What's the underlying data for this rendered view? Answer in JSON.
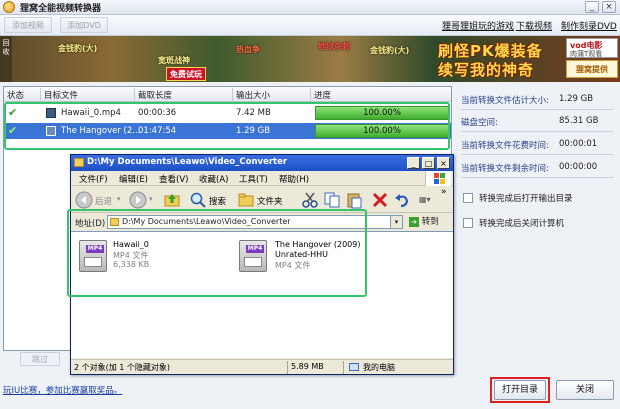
{
  "app": {
    "title": "狸窝全能视频转换器",
    "window_controls": {
      "minimize": "_",
      "close": "×"
    }
  },
  "toolbar": {
    "add_video": "添加视频",
    "add_dvd": "添加DVD",
    "links": [
      "狸哥狸姐玩的游戏",
      "下载视频",
      "制作刻录DVD"
    ]
  },
  "banner": {
    "side_text": "回收",
    "tags": [
      "金钱豹(大)",
      "宽斑战神",
      "热血争",
      "地狱杀刺",
      "金钱豹(大)"
    ],
    "buttons": [
      "免费试玩"
    ],
    "slogan_line1": "刷怪PK爆装备",
    "slogan_line2": "续写我的神奇",
    "vod_brand": "vod电影",
    "vod_sub": "肉蒲T观看",
    "logo": "狸窝提供"
  },
  "file_list": {
    "columns": [
      "状态",
      "目标文件",
      "截取长度",
      "输出大小",
      "进度"
    ],
    "rows": [
      {
        "name": "Hawaii_0.mp4",
        "duration": "00:00:36",
        "size": "7.42 MB",
        "progress_pct": 100,
        "progress_label": "100.00%"
      },
      {
        "name": "The Hangover (2...",
        "duration": "01:47:54",
        "size": "1.29 GB",
        "progress_pct": 100,
        "progress_label": "100.00%"
      }
    ],
    "skip_label": "跳过"
  },
  "info": {
    "items": [
      {
        "label": "当前转换文件估计大小:",
        "value": "1.29 GB"
      },
      {
        "label": "磁盘空间:",
        "value": "85.31 GB"
      },
      {
        "label": "当前转换文件花费时间:",
        "value": "00:00:01"
      },
      {
        "label": "当前转换文件剩余时间:",
        "value": "00:00:00"
      }
    ],
    "options": [
      "转换完成后打开输出目录",
      "转换完成后关闭计算机"
    ]
  },
  "explorer": {
    "title": "D:\\My Documents\\Leawo\\Video_Converter",
    "menu": [
      "文件(F)",
      "编辑(E)",
      "查看(V)",
      "收藏(A)",
      "工具(T)",
      "帮助(H)"
    ],
    "tools": {
      "back": "后退",
      "search": "搜索",
      "folders": "文件夹"
    },
    "address_label": "地址(D)",
    "address": "D:\\My Documents\\Leawo\\Video_Converter",
    "go": "转到",
    "files": [
      {
        "badge": "MP4",
        "name": "Hawaii_0",
        "type": "MP4 文件",
        "size": "6,338 KB"
      },
      {
        "badge": "MP4",
        "name": "The Hangover (2009)",
        "name2": "Unrated-HHU",
        "type": "MP4 文件"
      }
    ],
    "status": {
      "objects": "2 个对象(加 1 个隐藏对象)",
      "size": "5.89 MB",
      "location": "我的电脑"
    }
  },
  "bottom": {
    "link": "玩IU比赛，参加比赛赢取奖品。",
    "open_dir": "打开目录",
    "close": "关闭"
  },
  "colors": {
    "progress": "#3fae2c",
    "highlight_frame": "#34c46a",
    "red_frame": "#e02020",
    "explorer_title": "#1d4fc4"
  }
}
